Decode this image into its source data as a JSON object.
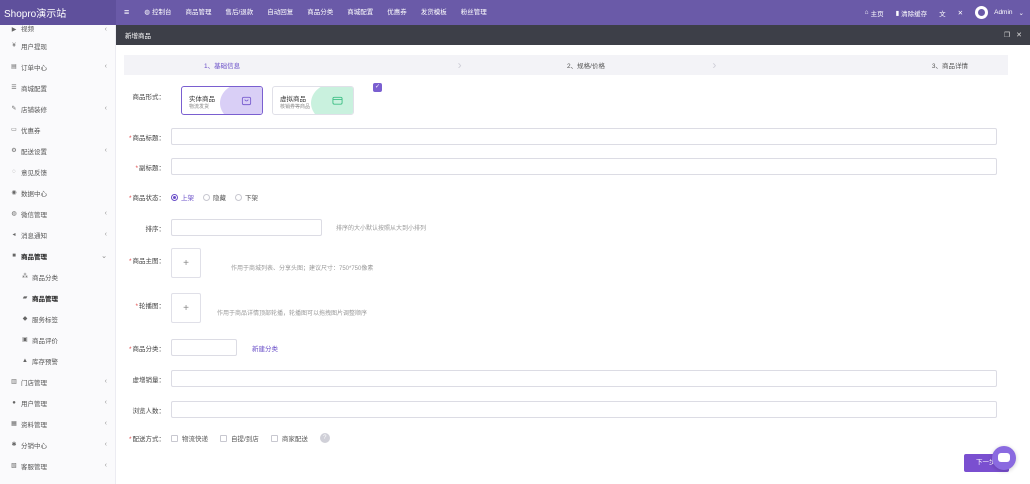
{
  "brand": "Shopro演示站",
  "nav": {
    "menu_icon": "≡",
    "items": [
      "控制台",
      "商品管理",
      "售后/退款",
      "自动回复",
      "商品分类",
      "商城配置",
      "优惠券",
      "发货模板",
      "粉丝管理"
    ],
    "right": [
      "主页",
      "清除缓存"
    ],
    "user": "Admin"
  },
  "sidebar": {
    "items": [
      {
        "label": "视频",
        "icon": "▶",
        "chev": "‹"
      },
      {
        "label": "用户提现",
        "icon": "¥",
        "chev": ""
      },
      {
        "label": "订单中心",
        "icon": "▤",
        "chev": "‹"
      },
      {
        "label": "商城配置",
        "icon": "☰",
        "chev": ""
      },
      {
        "label": "店铺装修",
        "icon": "✎",
        "chev": "‹"
      },
      {
        "label": "优惠券",
        "icon": "▭",
        "chev": ""
      },
      {
        "label": "配送设置",
        "icon": "⚙",
        "chev": "‹"
      },
      {
        "label": "意见反馈",
        "icon": "◌",
        "chev": ""
      },
      {
        "label": "数据中心",
        "icon": "◉",
        "chev": ""
      },
      {
        "label": "微信管理",
        "icon": "◍",
        "chev": "‹"
      },
      {
        "label": "消息通知",
        "icon": "◂",
        "chev": "‹"
      },
      {
        "label": "商品管理",
        "icon": "■",
        "chev": "⌄"
      },
      {
        "label": "商品分类",
        "icon": "⁂",
        "chev": ""
      },
      {
        "label": "商品管理",
        "icon": "▰",
        "chev": ""
      },
      {
        "label": "服务标签",
        "icon": "◆",
        "chev": ""
      },
      {
        "label": "商品评价",
        "icon": "▣",
        "chev": ""
      },
      {
        "label": "库存预警",
        "icon": "▲",
        "chev": ""
      },
      {
        "label": "门店管理",
        "icon": "▥",
        "chev": "‹"
      },
      {
        "label": "用户管理",
        "icon": "●",
        "chev": "‹"
      },
      {
        "label": "资料管理",
        "icon": "▦",
        "chev": "‹"
      },
      {
        "label": "分销中心",
        "icon": "✱",
        "chev": "‹"
      },
      {
        "label": "客服管理",
        "icon": "▧",
        "chev": "‹"
      }
    ]
  },
  "panel": {
    "title": "新增商品",
    "steps": [
      "1、基础信息",
      "2、规格/价格",
      "3、商品详情"
    ]
  },
  "form": {
    "type_label": "商品形式：",
    "physical": {
      "title": "实体商品",
      "desc": "物流发货",
      "color": "#a98ee8"
    },
    "virtual": {
      "title": "虚拟商品",
      "desc": "核销券等商品",
      "color": "#66d6a8"
    },
    "title_label": "商品标题：",
    "subtitle_label": "副标题：",
    "status_label": "商品状态：",
    "status_options": [
      "上架",
      "隐藏",
      "下架"
    ],
    "sort_label": "排序：",
    "sort_hint": "排序的大小默认按照从大到小排列",
    "image_label": "商品主图：",
    "image_hint": "作用于商城列表、分享头图；建议尺寸：750*750像素",
    "carousel_label": "轮播图：",
    "carousel_hint": "作用于商品详情顶部轮播，轮播图可以拖拽图片调整顺序",
    "category_label": "商品分类：",
    "new_category": "新建分类",
    "sales_label": "虚增销量：",
    "views_label": "浏览人数：",
    "delivery_label": "配送方式：",
    "delivery_options": [
      "物流快递",
      "自提/到店",
      "商家配送"
    ],
    "next": "下一步",
    "accent": "#6a4fc8"
  }
}
